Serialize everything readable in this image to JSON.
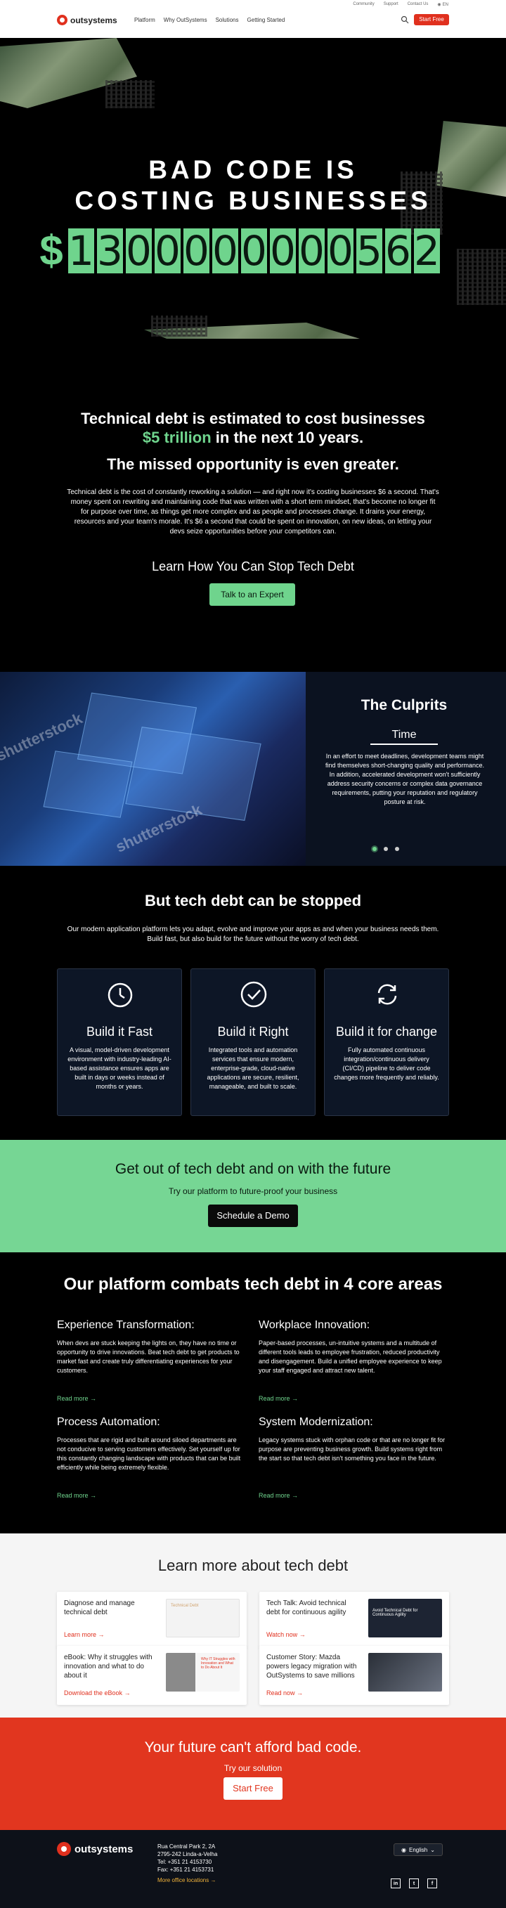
{
  "header": {
    "utility": [
      "Community",
      "Support",
      "Contact Us",
      "EN"
    ],
    "logo": "outsystems",
    "nav": [
      "Platform",
      "Why OutSystems",
      "Solutions",
      "Getting Started"
    ],
    "start_free": "Start Free"
  },
  "hero": {
    "title_line1": "BAD CODE IS",
    "title_line2": "COSTING BUSINESSES",
    "currency": "$",
    "counter": "1300000000562"
  },
  "intro": {
    "headline_a": "Technical debt is estimated to cost businesses",
    "headline_b_highlight": "$5 trillion",
    "headline_b_rest": " in the next 10 years.",
    "headline2": "The missed opportunity is even greater.",
    "body": "Technical debt is the cost of constantly reworking a solution — and right now it's costing businesses $6 a second. That's money spent on rewriting and maintaining code that was written with a short term mindset, that's become no longer fit for purpose over time, as things get more complex and as people and processes change. It drains your energy, resources and your team's morale. It's $6 a second that could be spent on innovation, on new ideas, on letting your devs seize opportunities before your competitors can.",
    "learn": "Learn How You Can Stop Tech Debt",
    "cta": "Talk to an Expert"
  },
  "culprits": {
    "title": "The Culprits",
    "tab": "Time",
    "body": "In an effort to meet deadlines, development teams might find themselves short-changing quality and performance. In addition, accelerated development won't sufficiently address security concerns or complex data governance requirements, putting your reputation and regulatory posture at risk.",
    "watermark": "shutterstock"
  },
  "stopped": {
    "title": "But tech debt can be stopped",
    "lead": "Our modern application platform lets you adapt, evolve and improve your apps as and when your business needs them. Build fast, but also build for the future without the worry of tech debt.",
    "cards": [
      {
        "title": "Build it Fast",
        "body": "A visual, model-driven development environment with industry-leading AI-based assistance ensures apps are built in days or weeks instead of months or years."
      },
      {
        "title": "Build it Right",
        "body": "Integrated tools and automation services that ensure modern, enterprise-grade, cloud-native applications are secure, resilient, manageable, and built to scale."
      },
      {
        "title": "Build it for change",
        "body": "Fully automated continuous integration/continuous delivery (CI/CD) pipeline to deliver code changes more frequently and reliably."
      }
    ]
  },
  "cta": {
    "title": "Get out of tech debt and on with the future",
    "sub": "Try our platform to future-proof your business",
    "button": "Schedule a Demo"
  },
  "platform": {
    "title": "Our platform combats tech debt in 4 core areas",
    "read_more": "Read more",
    "areas": [
      {
        "title": "Experience Transformation:",
        "body": "When devs are stuck keeping the lights on, they have no time or opportunity to drive innovations. Beat tech debt to get products to market fast and create truly differentiating experiences for your customers."
      },
      {
        "title": "Workplace Innovation:",
        "body": "Paper-based processes, un-intuitive systems and a multitude of different tools leads to employee frustration, reduced productivity and disengagement. Build a unified employee experience to keep your staff engaged and attract new talent."
      },
      {
        "title": "Process Automation:",
        "body": "Processes that are rigid and built around siloed departments are not conducive to serving customers effectively. Set yourself up for this constantly changing landscape with products that can be built efficiently while being extremely flexible."
      },
      {
        "title": "System Modernization:",
        "body": "Legacy systems stuck with orphan code or that are no longer fit for purpose are preventing business growth. Build systems right from the start so that tech debt isn't something you face in the future."
      }
    ]
  },
  "learn_more": {
    "title": "Learn more about tech debt",
    "cards": [
      {
        "title": "Diagnose and manage technical debt",
        "link": "Learn more",
        "thumb": "Technical Debt"
      },
      {
        "title": "Tech Talk: Avoid technical debt for continuous agility",
        "link": "Watch now",
        "thumb": "Avoid Technical Debt for Continuous Agility"
      },
      {
        "title": "eBook: Why it struggles with innovation and what to do about it",
        "link": "Download the eBook",
        "thumb": "Why IT Struggles with Innovation and What to Do About It"
      },
      {
        "title": "Customer Story: Mazda powers legacy migration with OutSystems to save millions",
        "link": "Read now",
        "thumb": ""
      }
    ]
  },
  "future": {
    "title": "Your future can't afford bad code.",
    "sub": "Try our solution",
    "button": "Start Free"
  },
  "footer": {
    "logo": "outsystems",
    "address": [
      "Rua Central Park 2, 2A",
      "2795-242 Linda-a-Velha",
      "Tel: +351 21 4153730",
      "Fax: +351 21 4153731"
    ],
    "more_offices": "More office locations",
    "language": "English",
    "social": [
      "in",
      "t",
      "f"
    ]
  },
  "colors": {
    "accent_green": "#6fd48d",
    "brand_red": "#e0301e",
    "cta_green": "#76d694"
  }
}
